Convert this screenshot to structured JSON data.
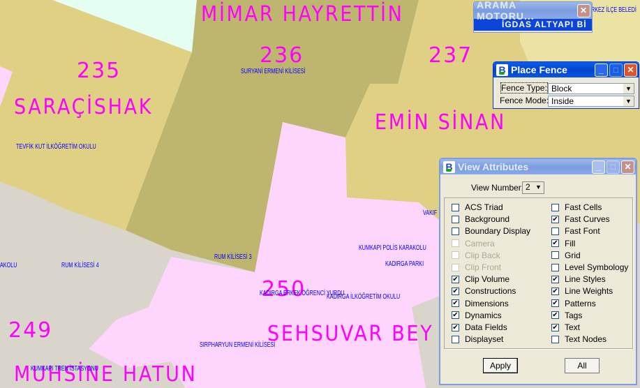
{
  "colors": {
    "label_magenta": "#ff00ff",
    "poi_blue": "#0000ff",
    "zone_tan": "#e0d083",
    "zone_olive": "#beb66e",
    "zone_pink": "#fed5fd",
    "zone_grey": "#d9d5cb",
    "zone_mint": "#e4fff1",
    "zone_light_tan": "#ebe3a3"
  },
  "map": {
    "district_names": [
      "MİMAR HAYRETTİN",
      "SARAÇİSHAK",
      "EMİN SİNAN",
      "SEHSUVAR BEY",
      "MUHSİNE HATUN"
    ],
    "block_numbers": [
      "235",
      "236",
      "237",
      "250",
      "249"
    ],
    "poi_labels": [
      "SURYANİ ERMENİ KİLİSESİ",
      "TEVFİK KUT İLKÖĞRETİM OKULU",
      "RUM KİLİSESİ 3",
      "RUM KİLİSESİ 4",
      "AKOLU",
      "KUMKAPI POLİS KARAKOLU",
      "KADIRGA PARKI",
      "KADIRGA ERKEK ÖĞRENCİ YURDU",
      "KADIRGA İLKÖĞRETİM OKULU",
      "SIRPHARYUN ERMENİ KİLİSESİ",
      "KUMKAPI TREN İSTASYONU",
      "VAKIF",
      "RKEZ İLÇE BELEDİ"
    ]
  },
  "search_window": {
    "title": "ARAMA MOTORU...",
    "selected_item": "İGDAS ALTYAPI Bİ"
  },
  "place_fence": {
    "title": "Place Fence",
    "fence_type_label": "Fence Type:",
    "fence_type_value": "Block",
    "fence_mode_label": "Fence Mode:",
    "fence_mode_value": "Inside"
  },
  "view_attributes": {
    "title": "View Attributes",
    "view_number_label": "View Number:",
    "view_number_value": "2",
    "left_column": [
      {
        "label": "ACS Triad",
        "checked": false,
        "enabled": true
      },
      {
        "label": "Background",
        "checked": false,
        "enabled": true
      },
      {
        "label": "Boundary Display",
        "checked": false,
        "enabled": true
      },
      {
        "label": "Camera",
        "checked": false,
        "enabled": false
      },
      {
        "label": "Clip Back",
        "checked": false,
        "enabled": false
      },
      {
        "label": "Clip Front",
        "checked": false,
        "enabled": false
      },
      {
        "label": "Clip Volume",
        "checked": true,
        "enabled": true
      },
      {
        "label": "Constructions",
        "checked": true,
        "enabled": true
      },
      {
        "label": "Dimensions",
        "checked": true,
        "enabled": true
      },
      {
        "label": "Dynamics",
        "checked": true,
        "enabled": true
      },
      {
        "label": "Data Fields",
        "checked": true,
        "enabled": true
      },
      {
        "label": "Displayset",
        "checked": false,
        "enabled": true
      }
    ],
    "right_column": [
      {
        "label": "Fast Cells",
        "checked": false,
        "enabled": true
      },
      {
        "label": "Fast Curves",
        "checked": true,
        "enabled": true
      },
      {
        "label": "Fast Font",
        "checked": false,
        "enabled": true
      },
      {
        "label": "Fill",
        "checked": true,
        "enabled": true
      },
      {
        "label": "Grid",
        "checked": false,
        "enabled": true
      },
      {
        "label": "Level Symbology",
        "checked": false,
        "enabled": true
      },
      {
        "label": "Line Styles",
        "checked": true,
        "enabled": true
      },
      {
        "label": "Line Weights",
        "checked": true,
        "enabled": true
      },
      {
        "label": "Patterns",
        "checked": true,
        "enabled": true
      },
      {
        "label": "Tags",
        "checked": true,
        "enabled": true
      },
      {
        "label": "Text",
        "checked": true,
        "enabled": true
      },
      {
        "label": "Text Nodes",
        "checked": false,
        "enabled": true
      }
    ],
    "apply_label": "Apply",
    "all_label": "All"
  }
}
